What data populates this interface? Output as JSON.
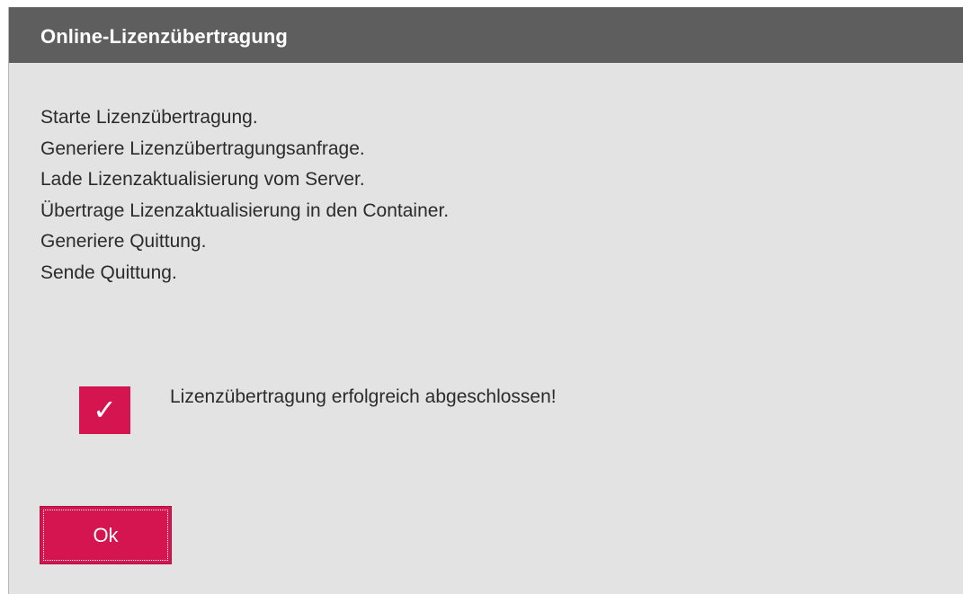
{
  "dialog": {
    "title": "Online-Lizenzübertragung",
    "log_lines": [
      "Starte Lizenzübertragung.",
      "Generiere Lizenzübertragungsanfrage.",
      "Lade Lizenzaktualisierung vom Server.",
      "Übertrage Lizenzaktualisierung in den Container.",
      "Generiere Quittung.",
      "Sende Quittung."
    ],
    "status": {
      "icon": "checkmark-icon",
      "glyph": "✓",
      "message": "Lizenzübertragung erfolgreich abgeschlossen!"
    },
    "ok_label": "Ok"
  },
  "colors": {
    "titlebar": "#5e5e5e",
    "dialog_background": "#e3e3e3",
    "accent": "#d4154f",
    "text": "#2b2b2b"
  }
}
